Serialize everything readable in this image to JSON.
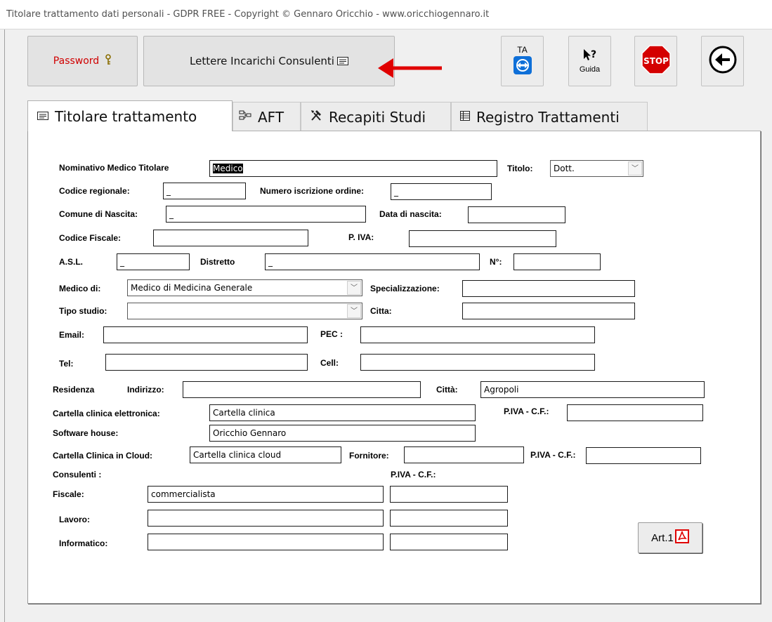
{
  "window": {
    "title": "Titolare trattamento dati personali - GDPR FREE - Copyright © Gennaro Oricchio - www.oricchiogennaro.it"
  },
  "toolbar": {
    "password_label": "Password",
    "password_icon": "key-icon",
    "letters_label": "Lettere Incarichi Consulenti",
    "letters_icon": "form-icon",
    "ta_label": "TA",
    "help_label": "Guida",
    "stop_label": "STOP",
    "accent_red": "#e00000",
    "stop_color": "#d40000"
  },
  "tabs": [
    {
      "label": "Titolare trattamento",
      "icon": "form-icon",
      "active": true
    },
    {
      "label": "AFT",
      "icon": "network-icon",
      "active": false
    },
    {
      "label": "Recapiti Studi",
      "icon": "tools-icon",
      "active": false
    },
    {
      "label": "Registro Trattamenti",
      "icon": "table-icon",
      "active": false
    }
  ],
  "form": {
    "nominativo_label": "Nominativo Medico Titolare",
    "nominativo_value": "Medico",
    "titolo_label": "Titolo:",
    "titolo_value": "Dott.",
    "codice_regionale_label": "Codice regionale:",
    "codice_regionale_value": "_",
    "numero_iscrizione_label": "Numero iscrizione ordine:",
    "numero_iscrizione_value": "_",
    "comune_nascita_label": "Comune di Nascita:",
    "comune_nascita_value": "_",
    "data_nascita_label": "Data di nascita:",
    "data_nascita_value": "",
    "codice_fiscale_label": "Codice Fiscale:",
    "codice_fiscale_value": "",
    "piva_label": "P. IVA:",
    "piva_value": "",
    "asl_label": "A.S.L.",
    "asl_value": "_",
    "distretto_label": "Distretto",
    "distretto_value": "_",
    "numero_label": "N°:",
    "numero_value": "",
    "medico_di_label": "Medico di:",
    "medico_di_value": "Medico di Medicina Generale",
    "specializzazione_label": "Specializzazione:",
    "specializzazione_value": "",
    "tipo_studio_label": "Tipo studio:",
    "tipo_studio_value": "",
    "citta_label": "Citta:",
    "citta_value": "",
    "email_label": "Email:",
    "email_value": "",
    "pec_label": "PEC :",
    "pec_value": "",
    "tel_label": "Tel:",
    "tel_value": "",
    "cell_label": "Cell:",
    "cell_value": "",
    "residenza_label": "Residenza",
    "indirizzo_label": "Indirizzo:",
    "indirizzo_value": "",
    "citta_res_label": "Città:",
    "citta_res_value": "Agropoli",
    "cartella_label": "Cartella clinica elettronica:",
    "cartella_value": "Cartella clinica",
    "piva_cf_label": "P.IVA - C.F.:",
    "cartella_piva_value": "",
    "software_house_label": "Software house:",
    "software_house_value": "Oricchio Gennaro",
    "cloud_label": "Cartella Clinica in Cloud:",
    "cloud_value": "Cartella clinica cloud",
    "fornitore_label": "Fornitore:",
    "fornitore_value": "",
    "cloud_piva_value": "",
    "consulenti_label": "Consulenti :",
    "consulenti_piva_label": "P.IVA - C.F.:",
    "fiscale_label": "Fiscale:",
    "fiscale_value": "commercialista",
    "fiscale_piva_value": "",
    "lavoro_label": "Lavoro:",
    "lavoro_value": "",
    "lavoro_piva_value": "",
    "informatico_label": "Informatico:",
    "informatico_value": "",
    "informatico_piva_value": "",
    "art1_label": "Art.1"
  }
}
